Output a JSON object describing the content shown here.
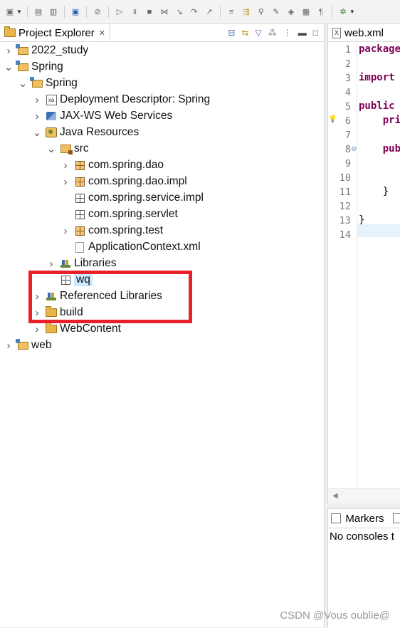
{
  "explorer": {
    "title": "Project Explorer",
    "tree": [
      {
        "label": "2022_study",
        "depth": 0,
        "chevron": ">",
        "icon": "project-icon"
      },
      {
        "label": "Spring",
        "depth": 0,
        "chevron": "v",
        "icon": "project-icon"
      },
      {
        "label": "Spring",
        "depth": 1,
        "chevron": "v",
        "icon": "web-project-icon"
      },
      {
        "label": "Deployment Descriptor: Spring",
        "depth": 2,
        "chevron": ">",
        "icon": "deployment-descriptor-icon"
      },
      {
        "label": "JAX-WS Web Services",
        "depth": 2,
        "chevron": ">",
        "icon": "web-services-icon"
      },
      {
        "label": "Java Resources",
        "depth": 2,
        "chevron": "v",
        "icon": "java-resources-icon"
      },
      {
        "label": "src",
        "depth": 3,
        "chevron": "v",
        "icon": "source-folder-icon"
      },
      {
        "label": "com.spring.dao",
        "depth": 4,
        "chevron": ">",
        "icon": "package-icon"
      },
      {
        "label": "com.spring.dao.impl",
        "depth": 4,
        "chevron": ">",
        "icon": "package-icon"
      },
      {
        "label": "com.spring.service.impl",
        "depth": 4,
        "chevron": "",
        "icon": "empty-package-icon"
      },
      {
        "label": "com.spring.servlet",
        "depth": 4,
        "chevron": "",
        "icon": "empty-package-icon"
      },
      {
        "label": "com.spring.test",
        "depth": 4,
        "chevron": ">",
        "icon": "package-icon"
      },
      {
        "label": "ApplicationContext.xml",
        "depth": 4,
        "chevron": "",
        "icon": "xml-file-icon"
      },
      {
        "label": "Libraries",
        "depth": 3,
        "chevron": ">",
        "icon": "library-icon"
      },
      {
        "label": "wq",
        "depth": 3,
        "chevron": "",
        "icon": "empty-package-icon",
        "selected": true
      },
      {
        "label": "Referenced Libraries",
        "depth": 2,
        "chevron": ">",
        "icon": "library-icon"
      },
      {
        "label": "build",
        "depth": 2,
        "chevron": ">",
        "icon": "folder-icon"
      },
      {
        "label": "WebContent",
        "depth": 2,
        "chevron": ">",
        "icon": "folder-icon"
      },
      {
        "label": "web",
        "depth": 0,
        "chevron": ">",
        "icon": "project-icon"
      }
    ]
  },
  "editor": {
    "tab_label": "web.xml",
    "line_numbers": [
      "1",
      "2",
      "3",
      "4",
      "5",
      "6",
      "7",
      "8",
      "9",
      "10",
      "11",
      "12",
      "13",
      "14"
    ],
    "lines": [
      {
        "n": 1,
        "text": "package",
        "kw": true
      },
      {
        "n": 3,
        "text": "import",
        "kw": true
      },
      {
        "n": 5,
        "text": "public",
        "kw": true
      },
      {
        "n": 6,
        "text": "    pri",
        "kw": true
      },
      {
        "n": 8,
        "text": "    pub",
        "kw": true
      },
      {
        "n": 11,
        "text": "    }",
        "kw": false
      },
      {
        "n": 13,
        "text": "}",
        "kw": false
      }
    ]
  },
  "console": {
    "tab_label": "Markers",
    "message": "No consoles t"
  },
  "watermark": "CSDN @Vous oublie@",
  "colors": {
    "highlight_box": "#e8202a",
    "selection": "#cce8ff",
    "keyword": "#7f0055"
  }
}
